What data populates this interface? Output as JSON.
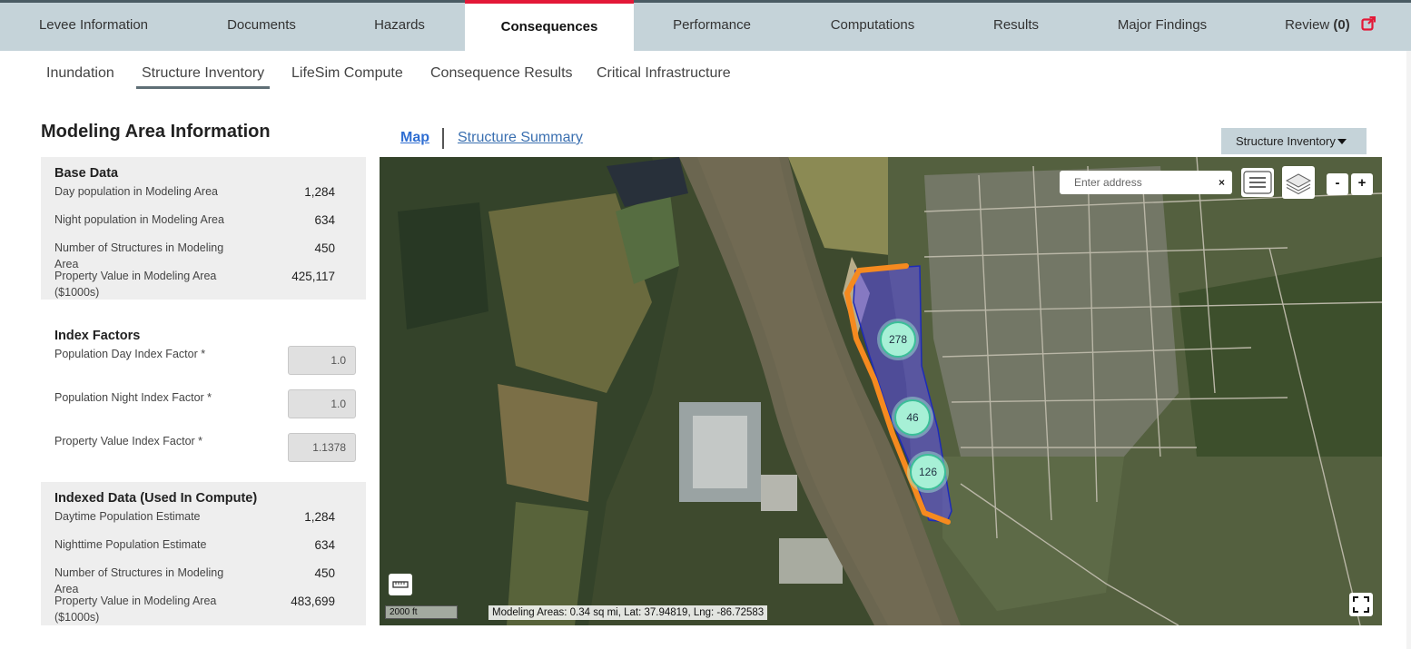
{
  "topnav": {
    "tabs": [
      "Levee Information",
      "Documents",
      "Hazards",
      "Consequences",
      "Performance",
      "Computations",
      "Results",
      "Major Findings"
    ],
    "review_label": "Review",
    "review_count": "(0)"
  },
  "subnav": {
    "tabs": [
      "Inundation",
      "Structure Inventory",
      "LifeSim Compute",
      "Consequence Results",
      "Critical Infrastructure"
    ]
  },
  "page_title": "Modeling Area Information",
  "base_data": {
    "title": "Base Data",
    "rows": [
      {
        "label": "Day population in Modeling Area",
        "value": "1,284"
      },
      {
        "label": "Night population in Modeling Area",
        "value": "634"
      },
      {
        "label": "Number of Structures in Modeling Area",
        "value": "450"
      },
      {
        "label": "Property Value in Modeling Area ($1000s)",
        "value": "425,117"
      }
    ]
  },
  "index_factors": {
    "title": "Index Factors",
    "rows": [
      {
        "label": "Population Day Index Factor *",
        "value": "1.0"
      },
      {
        "label": "Population Night Index Factor *",
        "value": "1.0"
      },
      {
        "label": "Property Value Index Factor *",
        "value": "1.1378"
      }
    ]
  },
  "indexed_data": {
    "title": "Indexed Data (Used In Compute)",
    "rows": [
      {
        "label": "Daytime Population Estimate",
        "value": "1,284"
      },
      {
        "label": "Nighttime Population Estimate",
        "value": "634"
      },
      {
        "label": "Number of Structures in Modeling Area",
        "value": "450"
      },
      {
        "label": "Property Value in Modeling Area ($1000s)",
        "value": "483,699"
      }
    ]
  },
  "map_tabs": {
    "map": "Map",
    "summary": "Structure Summary"
  },
  "layer_dropdown": "Structure Inventory",
  "map": {
    "address_placeholder": "Enter address",
    "clear": "×",
    "zoom_out": "-",
    "zoom_in": "+",
    "clusters": [
      "278",
      "46",
      "126"
    ],
    "scale": "2000 ft",
    "coords": "Modeling Areas: 0.34 sq mi, Lat: 37.94819, Lng: -86.72583"
  },
  "colors": {
    "accent_red": "#e31837",
    "nav_bg": "#c5d3d9",
    "levee_orange": "#f58a1f",
    "modeling_area": "#5c4ff0",
    "link_blue": "#2f6ed2"
  }
}
